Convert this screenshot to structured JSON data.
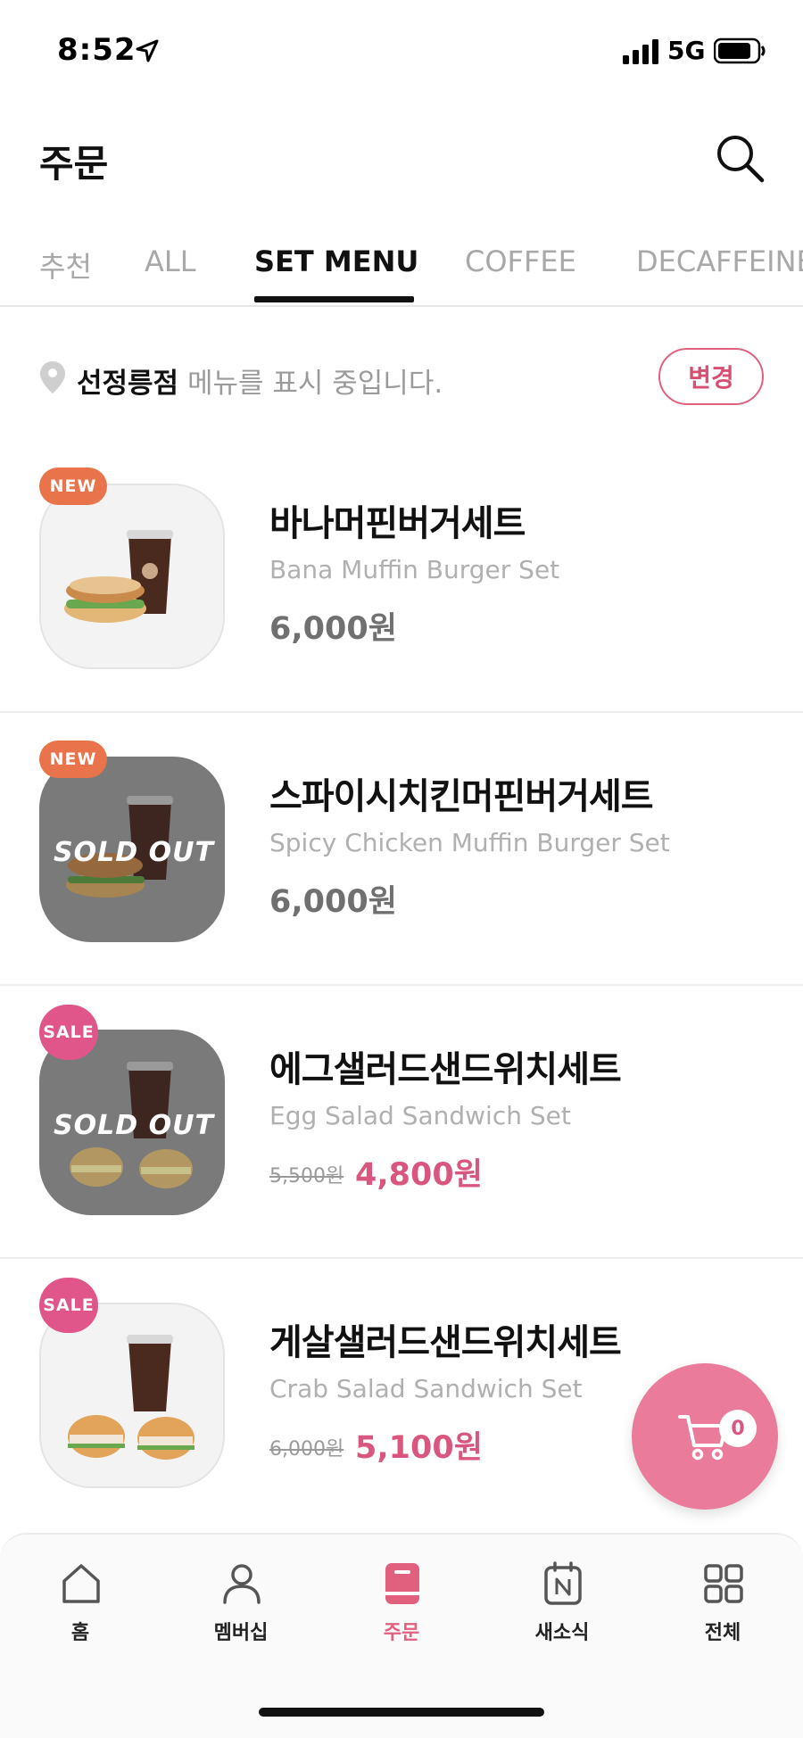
{
  "status_bar": {
    "time": "8:52",
    "network": "5G"
  },
  "header": {
    "title": "주문"
  },
  "tabs": [
    {
      "label": "추천",
      "active": false
    },
    {
      "label": "ALL",
      "active": false
    },
    {
      "label": "SET MENU",
      "active": true
    },
    {
      "label": "COFFEE",
      "active": false
    },
    {
      "label": "DECAFFEINE",
      "active": false
    }
  ],
  "store": {
    "name": "선정릉점",
    "message": " 메뉴를 표시 중입니다.",
    "change_label": "변경"
  },
  "menu_items": [
    {
      "badge": "NEW",
      "name": "바나머핀버거세트",
      "name_en": "Bana Muffin Burger Set",
      "price": "6,000원",
      "sold_out": false
    },
    {
      "badge": "NEW",
      "name": "스파이시치킨머핀버거세트",
      "name_en": "Spicy Chicken Muffin Burger Set",
      "price": "6,000원",
      "sold_out": true,
      "sold_out_label": "SOLD OUT"
    },
    {
      "badge": "SALE",
      "name": "에그샐러드샌드위치세트",
      "name_en": "Egg Salad Sandwich Set",
      "original_price": "5,500원",
      "price": "4,800원",
      "sold_out": true,
      "sold_out_label": "SOLD OUT"
    },
    {
      "badge": "SALE",
      "name": "게살샐러드샌드위치세트",
      "name_en": "Crab Salad Sandwich Set",
      "original_price": "6,000원",
      "price": "5,100원",
      "sold_out": false
    }
  ],
  "cart": {
    "count": "0"
  },
  "bottom_nav": [
    {
      "label": "홈",
      "icon": "home-icon",
      "active": false
    },
    {
      "label": "멤버십",
      "icon": "user-icon",
      "active": false
    },
    {
      "label": "주문",
      "icon": "order-icon",
      "active": true
    },
    {
      "label": "새소식",
      "icon": "news-icon",
      "active": false
    },
    {
      "label": "전체",
      "icon": "grid-icon",
      "active": false
    }
  ],
  "colors": {
    "accent": "#e0607e",
    "sale_price": "#d9577e",
    "new_badge": "#e9734a",
    "sale_badge": "#e0568a"
  }
}
